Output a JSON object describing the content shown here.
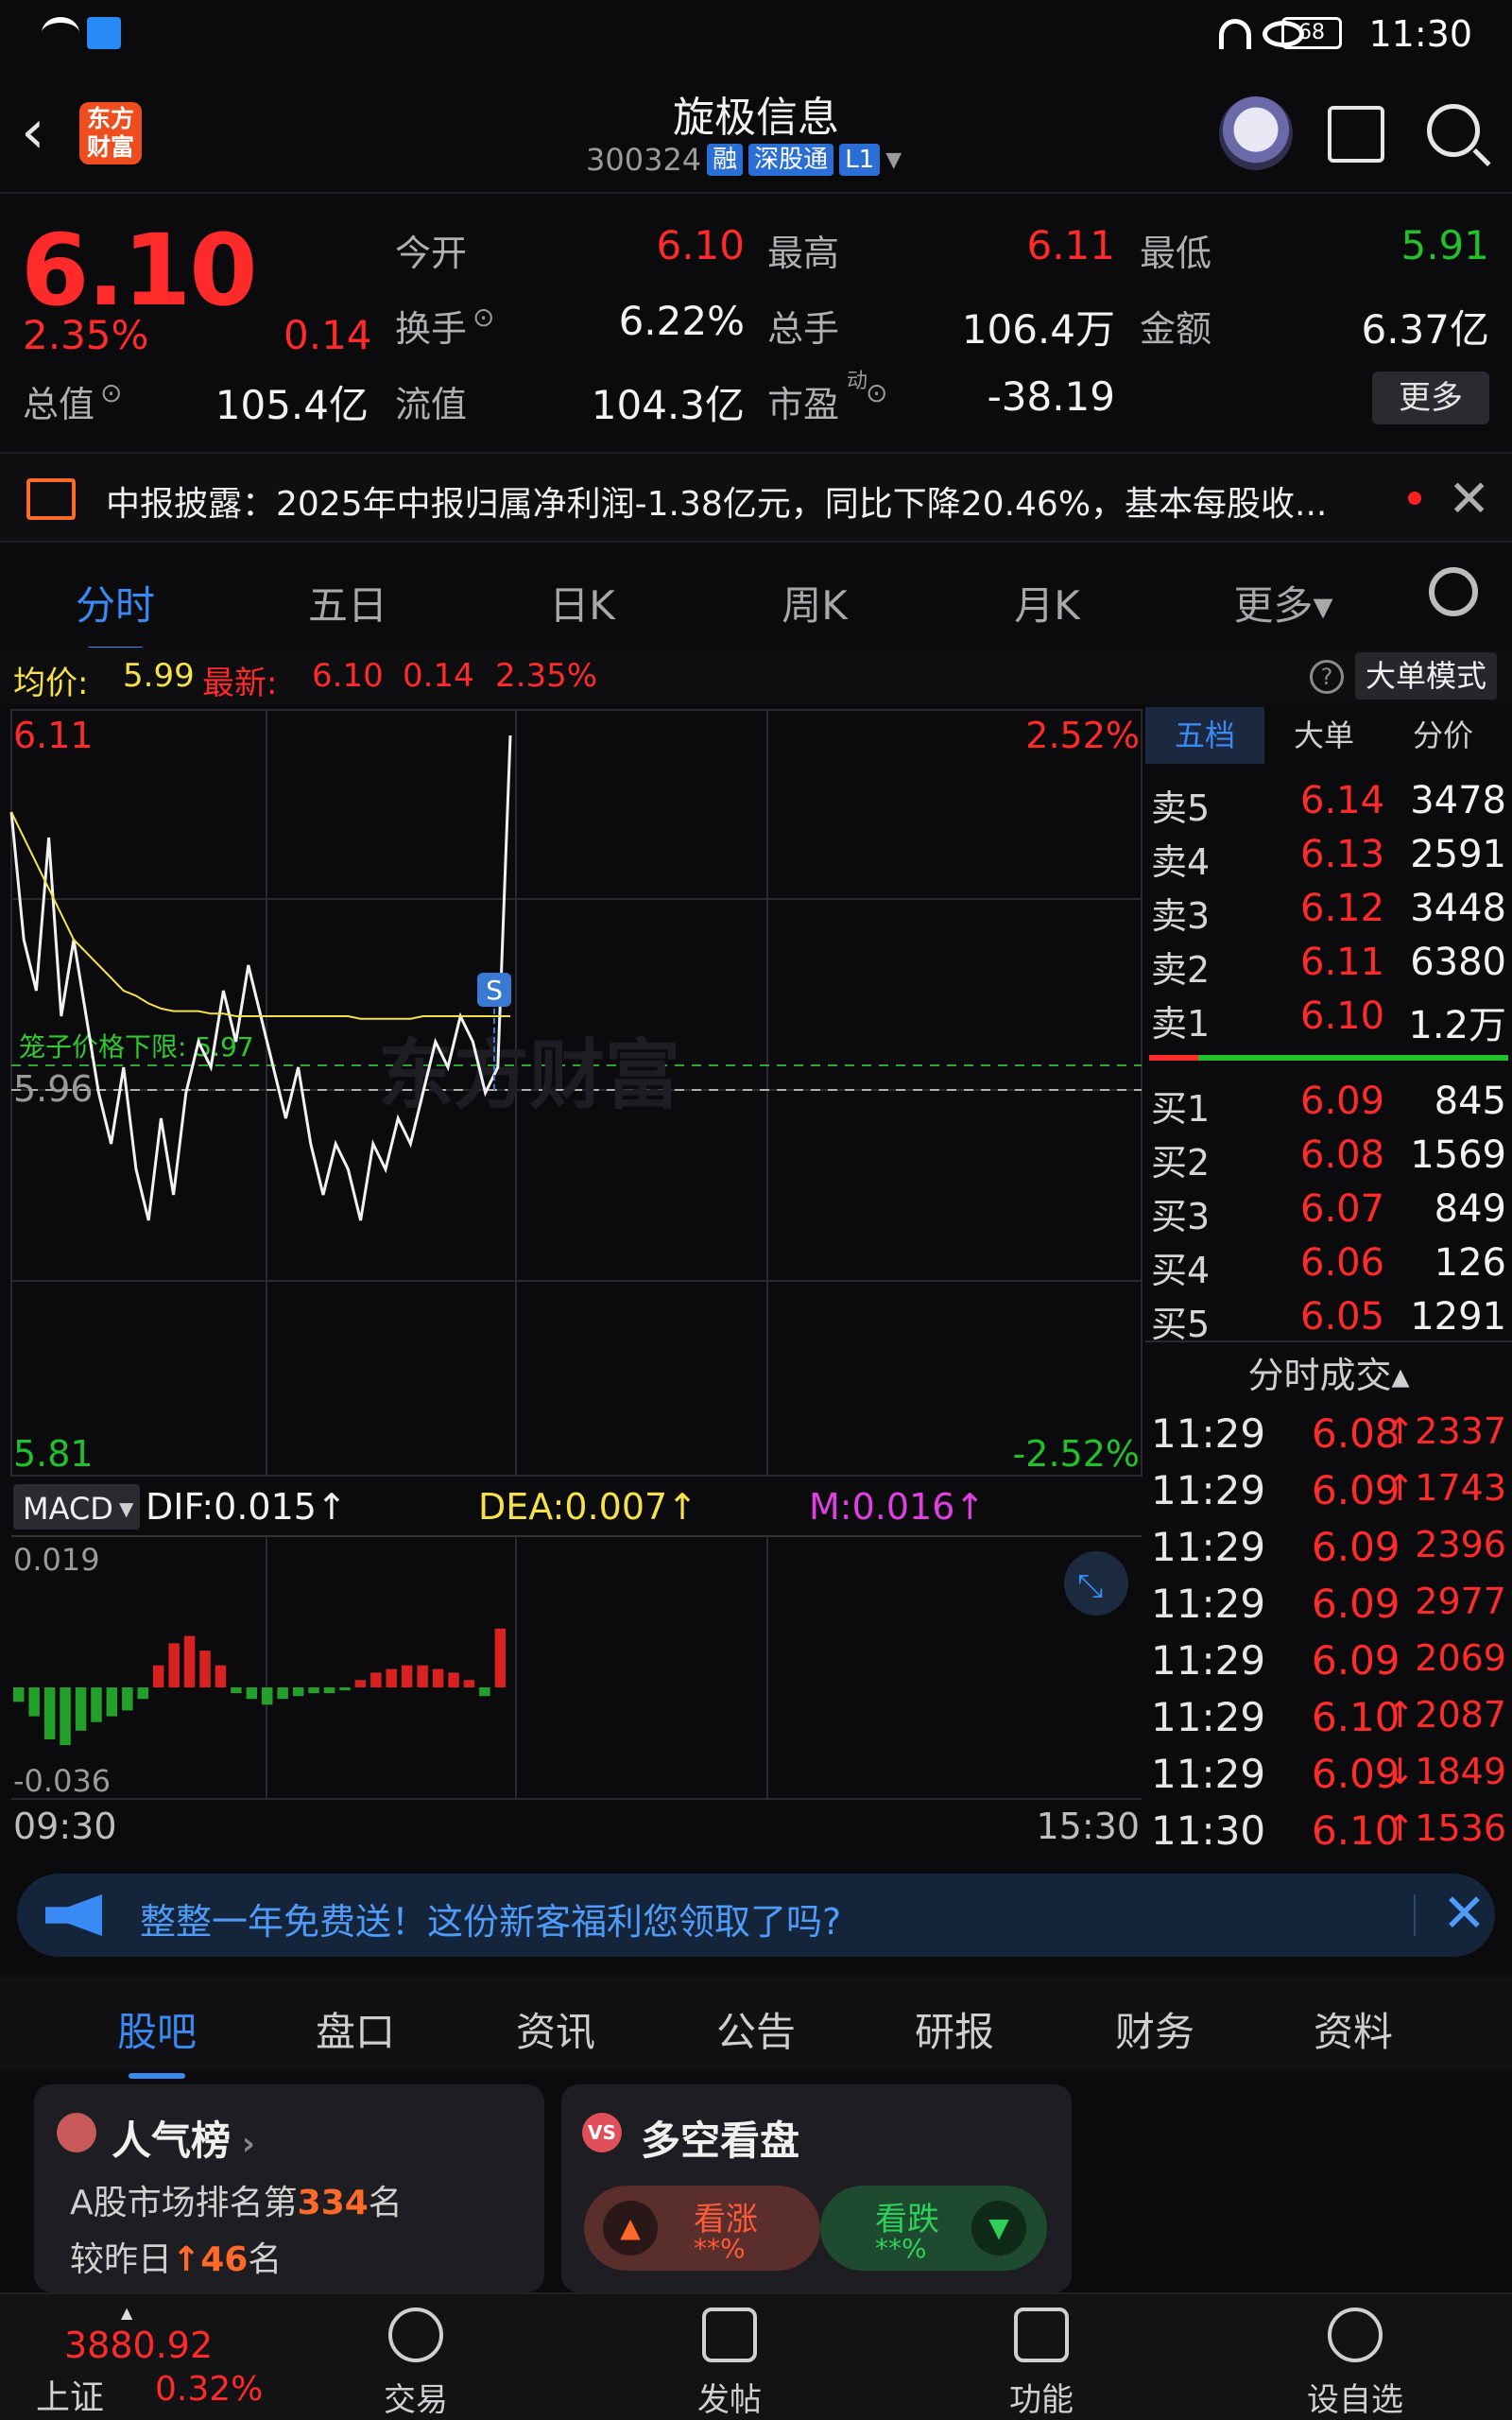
{
  "status": {
    "time": "11:30",
    "battery": "68"
  },
  "header": {
    "app_logo": "东方\n财富",
    "stock_name": "旋极信息",
    "stock_code": "300324",
    "tags": [
      "融",
      "深股通",
      "L1"
    ]
  },
  "quote": {
    "price": "6.10",
    "change_pct": "2.35%",
    "change": "0.14",
    "open_label": "今开",
    "open": "6.10",
    "high_label": "最高",
    "high": "6.11",
    "low_label": "最低",
    "low": "5.91",
    "turnover_label": "换手",
    "turnover": "6.22%",
    "volume_label": "总手",
    "volume": "106.4万",
    "amount_label": "金额",
    "amount": "6.37亿",
    "mktcap_label": "总值",
    "mktcap": "105.4亿",
    "float_label": "流值",
    "float": "104.3亿",
    "pe_label": "市盈",
    "pe_sup": "动",
    "pe": "-38.19",
    "more_button": "更多"
  },
  "notice": {
    "text": "中报披露：2025年中报归属净利润-1.38亿元，同比下降20.46%，基本每股收..."
  },
  "period_tabs": [
    "分时",
    "五日",
    "日K",
    "周K",
    "月K",
    "更多▾"
  ],
  "infoline": {
    "avg_label": "均价:",
    "avg": "5.99",
    "latest_label": "最新:",
    "latest": "6.10",
    "chg": "0.14",
    "pct": "2.35%",
    "mode_button": "大单模式"
  },
  "chart_data": {
    "type": "line",
    "title": "",
    "y_top": "6.11",
    "y_bottom": "5.81",
    "y_mid": "5.96",
    "pct_top": "2.52%",
    "pct_bottom": "-2.52%",
    "limit_label": "笼子价格下限: 5.97",
    "signal": "S",
    "watermark": "东方财富",
    "x_start": "09:30",
    "x_end": "15:30",
    "ylim": [
      5.81,
      6.11
    ],
    "series": [
      {
        "values": [
          6.07,
          6.02,
          6.0,
          6.06,
          5.99,
          6.02,
          5.99,
          5.96,
          5.94,
          5.97,
          5.93,
          5.91,
          5.95,
          5.92,
          5.96,
          5.98,
          5.97,
          6.0,
          5.98,
          6.01,
          5.99,
          5.97,
          5.95,
          5.97,
          5.94,
          5.92,
          5.94,
          5.93,
          5.91,
          5.94,
          5.93,
          5.95,
          5.94,
          5.96,
          5.98,
          5.97,
          5.99,
          5.98,
          5.96,
          5.97,
          6.1
        ]
      },
      {
        "values": [
          6.07,
          6.06,
          6.05,
          6.04,
          6.03,
          6.02,
          6.015,
          6.01,
          6.005,
          6.0,
          5.998,
          5.995,
          5.993,
          5.992,
          5.992,
          5.992,
          5.991,
          5.991,
          5.99,
          5.99,
          5.99,
          5.99,
          5.99,
          5.99,
          5.99,
          5.99,
          5.99,
          5.99,
          5.989,
          5.989,
          5.989,
          5.989,
          5.989,
          5.99,
          5.99,
          5.99,
          5.99,
          5.99,
          5.99,
          5.99,
          5.99
        ]
      }
    ]
  },
  "macd": {
    "label": "MACD",
    "dif": "DIF:0.015↑",
    "dea": "DEA:0.007↑",
    "m": "M:0.016↑",
    "top": "0.019",
    "bottom": "-0.036",
    "bars": [
      -0.005,
      -0.01,
      -0.018,
      -0.02,
      -0.015,
      -0.012,
      -0.01,
      -0.008,
      -0.004,
      0.006,
      0.012,
      0.014,
      0.01,
      0.006,
      -0.002,
      -0.004,
      -0.006,
      -0.004,
      -0.003,
      -0.002,
      -0.002,
      -0.001,
      0.002,
      0.004,
      0.005,
      0.006,
      0.006,
      0.005,
      0.004,
      0.002,
      -0.003,
      0.016
    ]
  },
  "orderbook": {
    "tabs": [
      "五档",
      "大单",
      "分价"
    ],
    "asks": [
      {
        "label": "卖5",
        "price": "6.14",
        "vol": "3478"
      },
      {
        "label": "卖4",
        "price": "6.13",
        "vol": "2591"
      },
      {
        "label": "卖3",
        "price": "6.12",
        "vol": "3448"
      },
      {
        "label": "卖2",
        "price": "6.11",
        "vol": "6380"
      },
      {
        "label": "卖1",
        "price": "6.10",
        "vol": "1.2万"
      }
    ],
    "bids": [
      {
        "label": "买1",
        "price": "6.09",
        "vol": "845"
      },
      {
        "label": "买2",
        "price": "6.08",
        "vol": "1569"
      },
      {
        "label": "买3",
        "price": "6.07",
        "vol": "849"
      },
      {
        "label": "买4",
        "price": "6.06",
        "vol": "126"
      },
      {
        "label": "买5",
        "price": "6.05",
        "vol": "1291"
      }
    ],
    "ticks_title": "分时成交▴",
    "ticks": [
      {
        "time": "11:29",
        "price": "6.08",
        "vol": "↑2337"
      },
      {
        "time": "11:29",
        "price": "6.09",
        "vol": "↑1743"
      },
      {
        "time": "11:29",
        "price": "6.09",
        "vol": "2396"
      },
      {
        "time": "11:29",
        "price": "6.09",
        "vol": "2977"
      },
      {
        "time": "11:29",
        "price": "6.09",
        "vol": "2069"
      },
      {
        "time": "11:29",
        "price": "6.10",
        "vol": "↑2087"
      },
      {
        "time": "11:29",
        "price": "6.09",
        "vol": "↓1849"
      },
      {
        "time": "11:30",
        "price": "6.10",
        "vol": "↑1536"
      }
    ]
  },
  "promo": {
    "text": "整整一年免费送！这份新客福利您领取了吗?"
  },
  "section_tabs": [
    "股吧",
    "盘口",
    "资讯",
    "公告",
    "研报",
    "财务",
    "资料"
  ],
  "cards": {
    "popular_title": "人气榜",
    "rank_prefix": "A股市场排名第",
    "rank": "334",
    "rank_suffix": "名",
    "change_prefix": "较昨日",
    "change": "46",
    "change_suffix": "名",
    "vote_title": "多空看盘",
    "bull_label": "看涨",
    "bull_pct": "**%",
    "bear_label": "看跌",
    "bear_pct": "**%"
  },
  "bottom_nav": {
    "index_value": "3880.92",
    "index_name": "上证",
    "index_pct": "0.32%",
    "items": [
      "交易",
      "发帖",
      "功能",
      "设自选"
    ]
  }
}
